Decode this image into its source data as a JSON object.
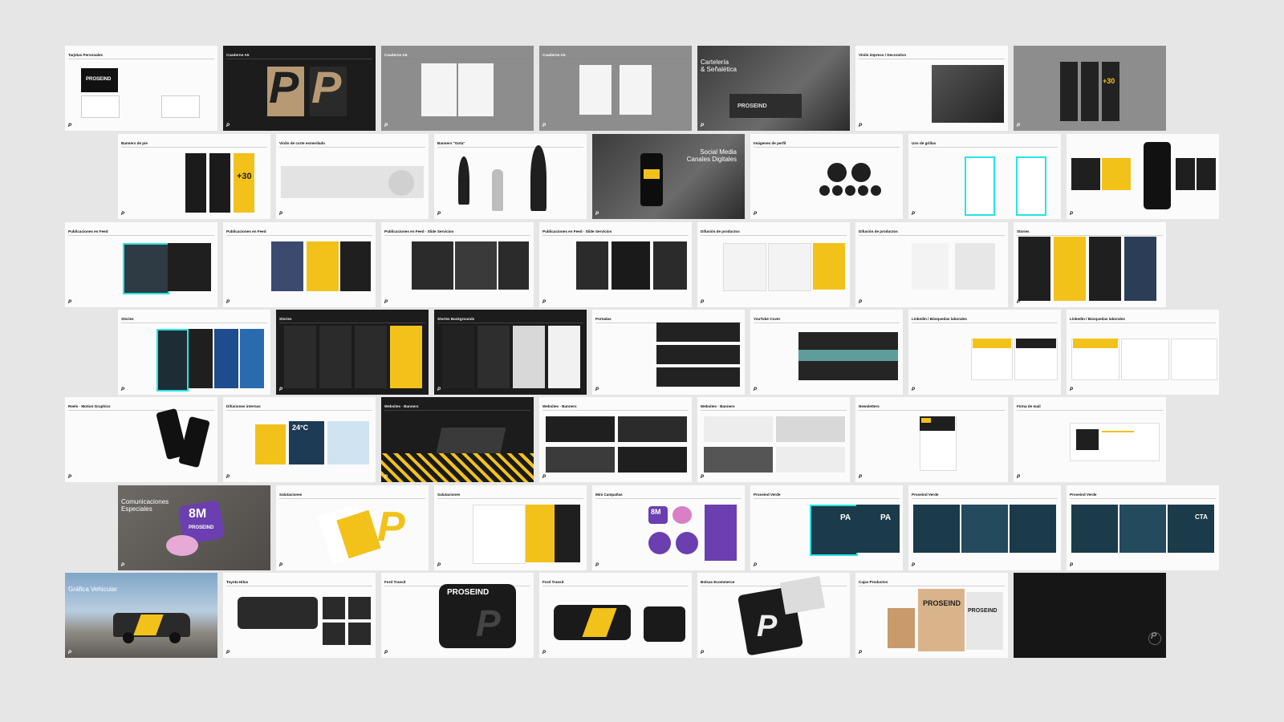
{
  "colors": {
    "background": "#e6e6e6",
    "accent": "#f2c21b",
    "highlight": "#27e3e3",
    "dark": "#1c1c1c"
  },
  "brand": {
    "mark": "P",
    "wordmark": "PROSEIND"
  },
  "rows": [
    {
      "slides": [
        {
          "title": "Tarjetas Personales",
          "theme": "light"
        },
        {
          "title": "Cuaderno A5",
          "theme": "dark"
        },
        {
          "title": "Cuaderno A5",
          "theme": "gray"
        },
        {
          "title": "Cuaderno A5",
          "theme": "gray"
        },
        {
          "title": "Cartelería\n& Señalética",
          "theme": "photo"
        },
        {
          "title": "Vinilo impreso / Decorativo",
          "theme": "light"
        },
        {
          "title": "",
          "theme": "gray"
        }
      ]
    },
    {
      "slides": [
        {
          "title": "Banners de pie",
          "theme": "light"
        },
        {
          "title": "Vinilo de corte esmerilado",
          "theme": "light"
        },
        {
          "title": "Banners \"Gota\"",
          "theme": "light"
        },
        {
          "title": "Social Media\nCanales Digitales",
          "theme": "photo"
        },
        {
          "title": "Imágenes de perfil",
          "theme": "light"
        },
        {
          "title": "Uso de grillas",
          "theme": "light"
        },
        {
          "title": "",
          "theme": "light"
        }
      ]
    },
    {
      "slides": [
        {
          "title": "Publicaciones en Feed",
          "theme": "light"
        },
        {
          "title": "Publicaciones en Feed",
          "theme": "light"
        },
        {
          "title": "Publicaciones en Feed · Slide Servicios",
          "theme": "light"
        },
        {
          "title": "Publicaciones en Feed · Slide Servicios",
          "theme": "light"
        },
        {
          "title": "Difusión de productos",
          "theme": "light"
        },
        {
          "title": "Difusión de productos",
          "theme": "light"
        },
        {
          "title": "Stories",
          "theme": "light"
        }
      ]
    },
    {
      "slides": [
        {
          "title": "Stories",
          "theme": "light"
        },
        {
          "title": "Stories",
          "theme": "dark"
        },
        {
          "title": "Stories Backgrounds",
          "theme": "dark"
        },
        {
          "title": "Portadas",
          "theme": "light"
        },
        {
          "title": "YouTube Cover",
          "theme": "light"
        },
        {
          "title": "LinkedIn / Búsquedas laborales",
          "theme": "light"
        },
        {
          "title": "LinkedIn / Búsquedas laborales",
          "theme": "light"
        }
      ]
    },
    {
      "slides": [
        {
          "title": "Reels · Motion Graphics",
          "theme": "light"
        },
        {
          "title": "Difusiones internas",
          "theme": "light"
        },
        {
          "title": "Websites · Banners",
          "theme": "dark"
        },
        {
          "title": "Websites · Banners",
          "theme": "light"
        },
        {
          "title": "Websites · Banners",
          "theme": "light"
        },
        {
          "title": "Newsletters",
          "theme": "light"
        },
        {
          "title": "Firma de mail",
          "theme": "light"
        }
      ]
    },
    {
      "slides": [
        {
          "title": "Comunicaciones\nEspeciales",
          "theme": "concrete"
        },
        {
          "title": "Salutaciones",
          "theme": "light"
        },
        {
          "title": "Salutaciones",
          "theme": "light"
        },
        {
          "title": "Mini Campañas",
          "theme": "light"
        },
        {
          "title": "Proseind Verde",
          "theme": "light"
        },
        {
          "title": "Proseind Verde",
          "theme": "light"
        },
        {
          "title": "Proseind Verde",
          "theme": "light"
        }
      ]
    },
    {
      "slides": [
        {
          "title": "Gráfica Vehicular",
          "theme": "sky"
        },
        {
          "title": "Toyota Hilux",
          "theme": "light"
        },
        {
          "title": "Ford Transit",
          "theme": "light"
        },
        {
          "title": "Ford Transit",
          "theme": "light"
        },
        {
          "title": "Bolsas Ecommerce",
          "theme": "light"
        },
        {
          "title": "Cajas Productos",
          "theme": "light"
        },
        {
          "title": "",
          "theme": "black"
        }
      ]
    }
  ],
  "texts": {
    "stat": "+30",
    "badge": "8M",
    "badge_sub": "PROSEIND",
    "van_word": "PROSEIND",
    "temp": "24°C",
    "pa": "PA",
    "cta": "CTA"
  }
}
